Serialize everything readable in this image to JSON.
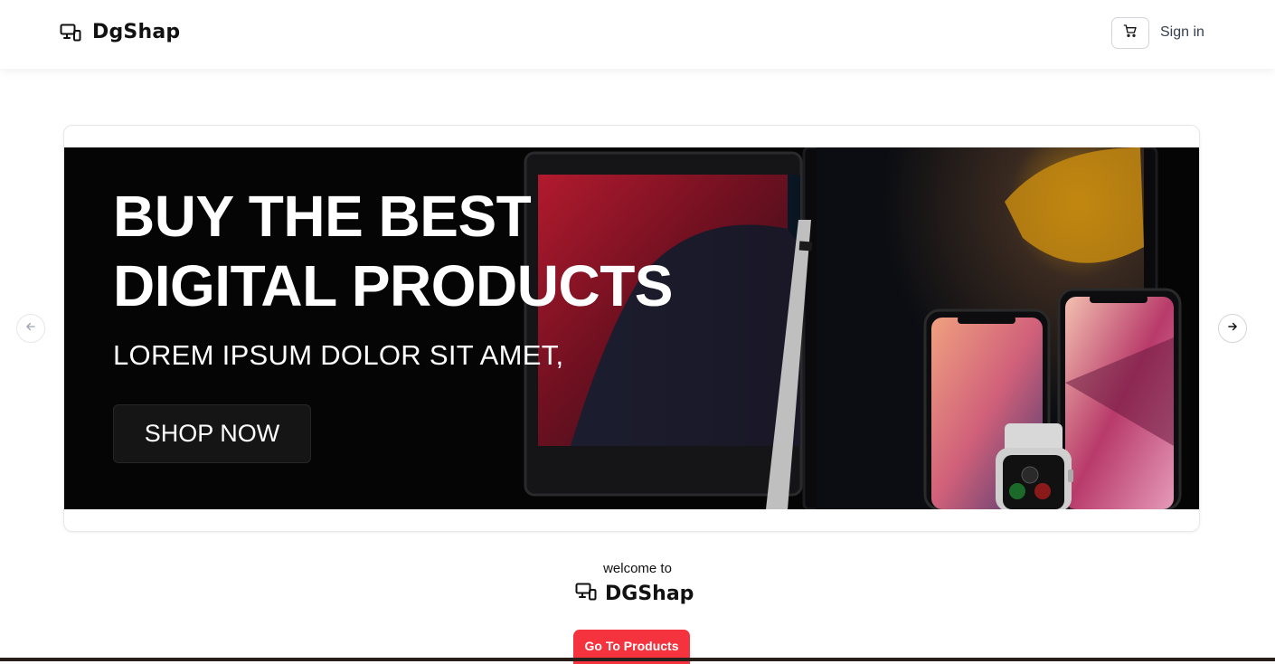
{
  "header": {
    "brand_name": "DgShap",
    "brand_icon": "devices-icon",
    "cart_icon": "cart-icon",
    "signin_label": "Sign in"
  },
  "hero": {
    "headline_line1": "BUY THE BEST",
    "headline_line2": "DIGITAL PRODUCTS",
    "subheadline": "LOREM IPSUM DOLOR SIT AMET,",
    "cta_label": "SHOP NOW",
    "prev_icon": "arrow-left-icon",
    "next_icon": "arrow-right-icon"
  },
  "welcome": {
    "intro": "welcome to",
    "brand_name": "DGShap",
    "cta_label": "Go To Products"
  },
  "colors": {
    "accent": "#f5333f",
    "banner_bg": "#050505"
  }
}
